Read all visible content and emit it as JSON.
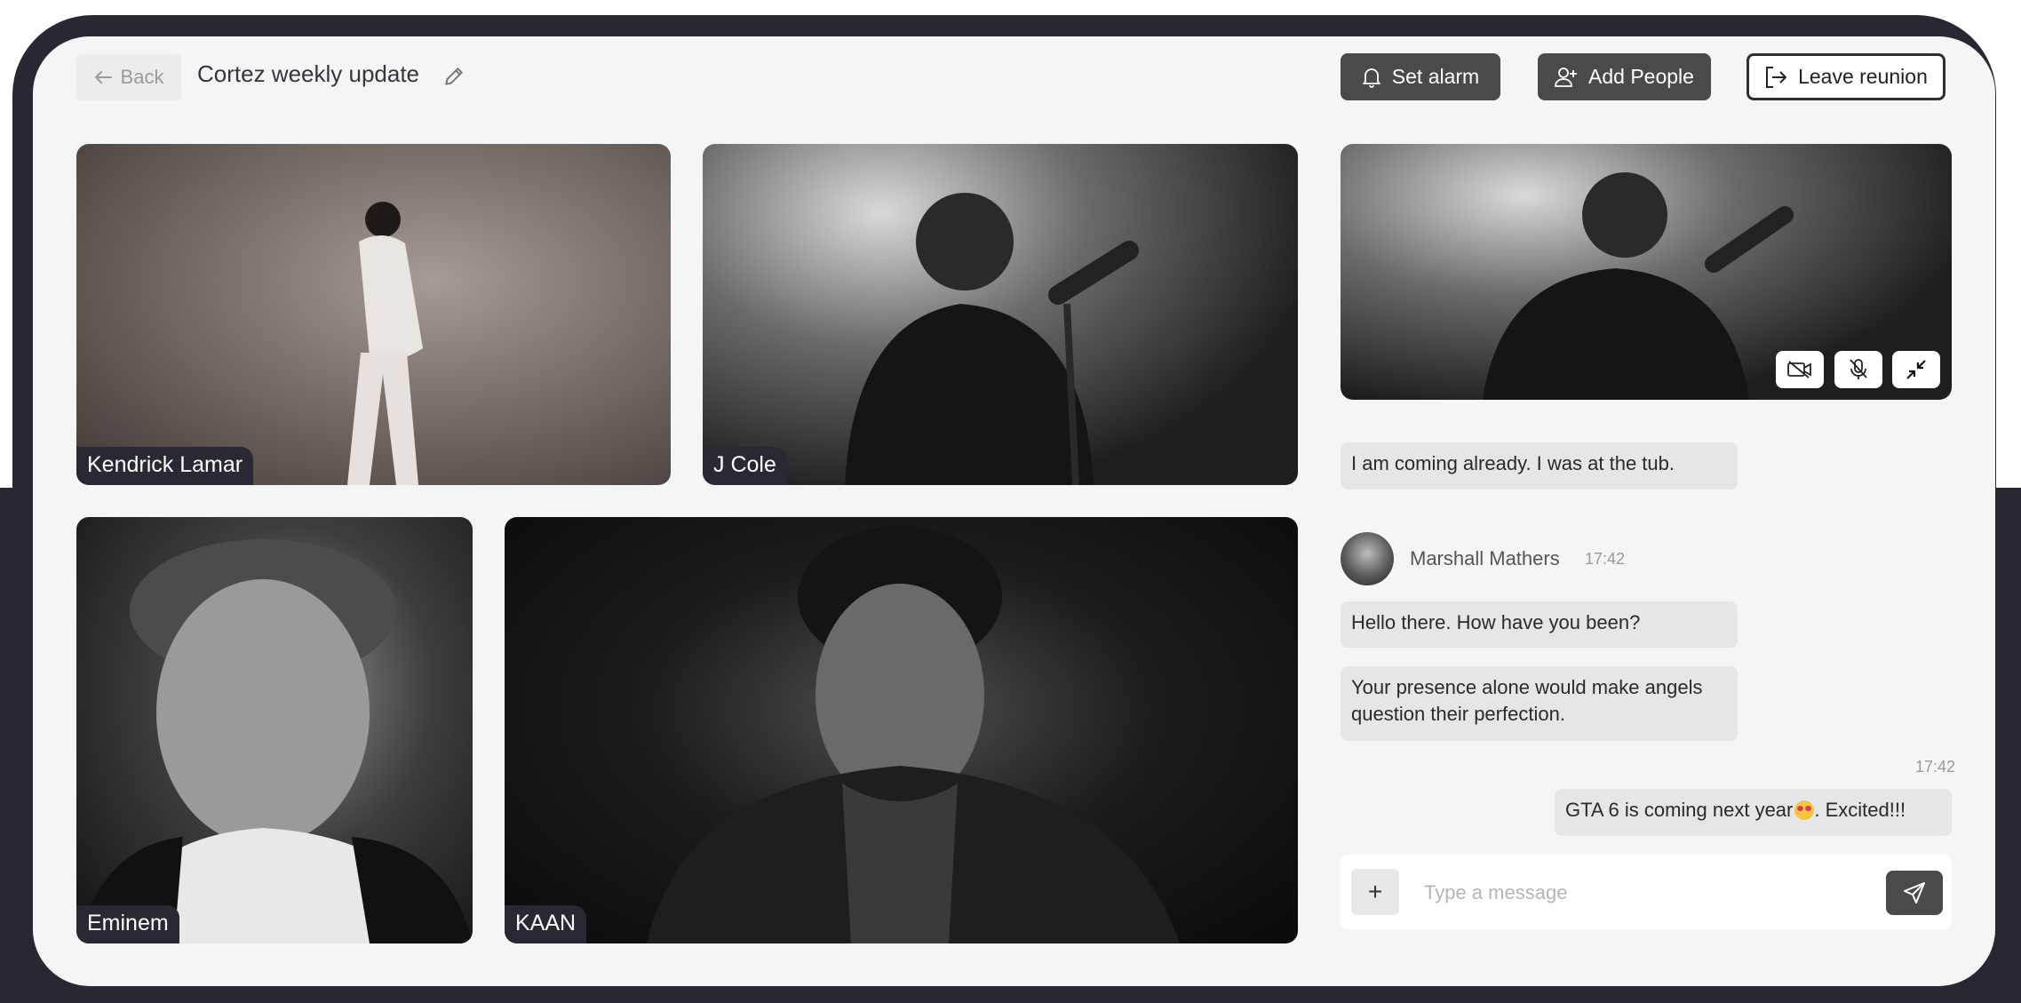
{
  "header": {
    "back_label": "Back",
    "title": "Cortez weekly update",
    "set_alarm_label": "Set alarm",
    "add_people_label": "Add People",
    "leave_label": "Leave reunion"
  },
  "participants": [
    {
      "name": "Kendrick Lamar"
    },
    {
      "name": "J Cole"
    },
    {
      "name": "Eminem"
    },
    {
      "name": "KAAN"
    }
  ],
  "chat": {
    "messages": [
      {
        "text": "I am coming already. I was at the tub."
      },
      {
        "sender": "Marshall Mathers",
        "time": "17:42"
      },
      {
        "text": "Hello there. How have you been?"
      },
      {
        "text": "Your presence alone would make angels question their perfection."
      },
      {
        "time": "17:42",
        "text_before": "GTA 6 is coming next year",
        "emoji": "heart-eyes-emoji",
        "text_after": ". Excited!!!"
      }
    ],
    "composer": {
      "placeholder": "Type a message",
      "plus_label": "+"
    }
  },
  "colors": {
    "frame": "#2a2733",
    "card": "#f5f5f5",
    "dark_button": "#4a4a4a",
    "bubble": "#e6e6e8"
  }
}
